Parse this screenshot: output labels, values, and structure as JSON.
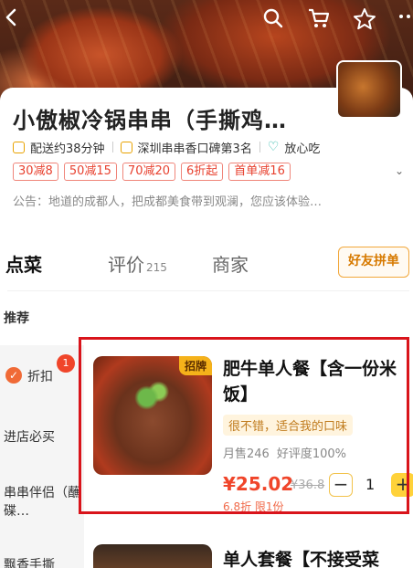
{
  "header": {
    "back_icon": "back-arrow-icon",
    "search_icon": "search-icon",
    "cart_icon": "cart-icon",
    "favorite_icon": "star-icon",
    "more_icon": "more-icon"
  },
  "shop": {
    "name": "小傲椒冷锅串串（手撕鸡…",
    "delivery": "配送约38分钟",
    "ranking": "深圳串串香口碑第3名",
    "safe": "放心吃",
    "promos": [
      "30减8",
      "50减15",
      "70减20",
      "6折起",
      "首单减16"
    ],
    "notice": "公告：地道的成都人，把成都美食带到观澜，您应该体验…"
  },
  "tabs": {
    "order": "点菜",
    "reviews": "评价",
    "reviews_count": "215",
    "merchant": "商家",
    "group_order": "好友拼单"
  },
  "sidebar": {
    "recommend": "推荐",
    "discount": "折扣",
    "discount_badge": "1",
    "must_buy": "进店必买",
    "skewer": "串串伴侣（蘸碟…",
    "last": "飘香手撕"
  },
  "dish": {
    "tag": "招牌",
    "title": "肥牛单人餐【含一份米饭】",
    "quote": "很不错，适合我的口味",
    "monthly_sales": "月售246",
    "rating": "好评度100%",
    "price": "¥25.02",
    "old_price": "¥36.8",
    "quantity": "1",
    "minus": "−",
    "plus": "+",
    "limit": "6.8折 限1份"
  },
  "dish2": {
    "title": "单人套餐【不接受菜"
  },
  "colors": {
    "accent": "#f0452a",
    "highlight": "#d9141b",
    "brand_yellow": "#ffd23a"
  }
}
